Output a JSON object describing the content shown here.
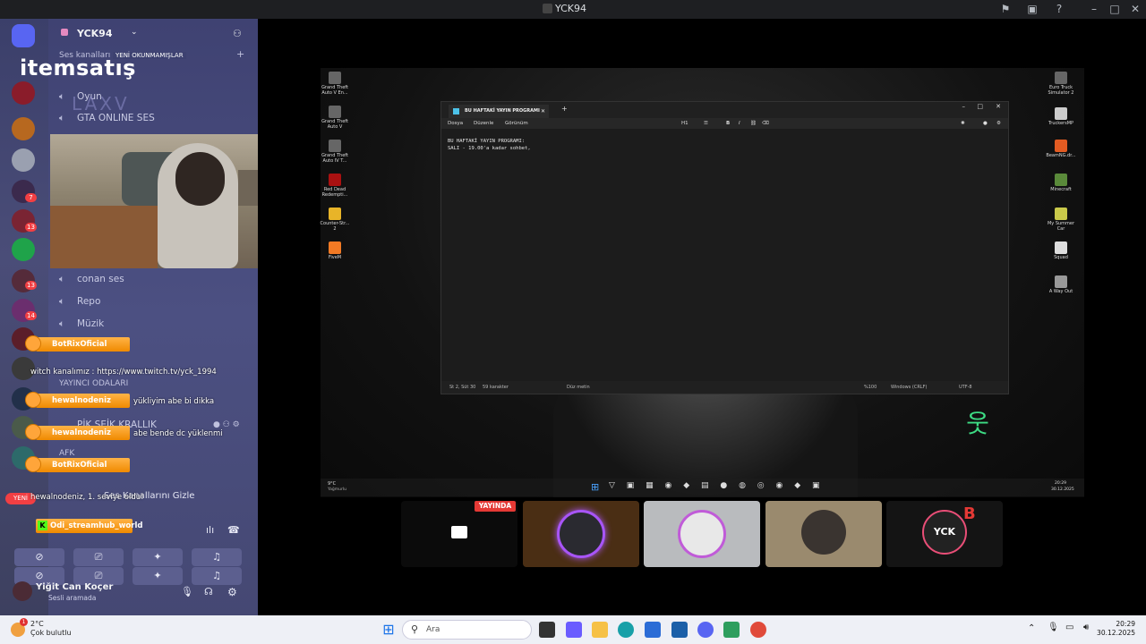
{
  "window": {
    "title": "YCK94"
  },
  "server": {
    "name": "YCK94"
  },
  "watermark": {
    "brand": "itemsatış",
    "sub": "LAXV"
  },
  "channels": {
    "category_voice": "Ses kanalları",
    "unread_label": "YENİ OKUNMAMIŞLAR",
    "items": [
      "Oyun",
      "GTA ONLINE SES",
      "conan ses",
      "Repo",
      "Müzik"
    ],
    "stream_category": "YAYINCI ODALARI",
    "kingdom": "PİK SEİK KRALLIK",
    "afk": "AFK",
    "hide_label": "Ses Kanallarını Gizle",
    "new_label": "YENİ"
  },
  "overlay": {
    "bot1": "BotRixOficial",
    "twitch_line": "witch kanalımız : https://www.twitch.tv/yck_1994",
    "user1": "hewalnodeniz",
    "msg1": "yükliyim abe bi dikka",
    "user2": "hewalnodeniz",
    "msg2": "abe bende dc yüklenmi",
    "bot2": "BotRixOficial",
    "level_line": "hewalnodeniz, 1. seviye oldu!",
    "kick_user": "Odi_streamhub_world"
  },
  "user": {
    "name": "Yiğit Can Koçer",
    "status": "Sesli aramada"
  },
  "notepad": {
    "tab_title": "BU HAFTAKİ YAYIN PROGRAMI",
    "menu": [
      "Dosya",
      "Düzenle",
      "Görünüm"
    ],
    "heading_tool": "H1",
    "lines": [
      "BU HAFTAKİ YAYIN PROGRAMI:",
      "SALI - 19.00'a kadar sohbet,"
    ],
    "status": {
      "pos": "St 2, Süt 30",
      "chars": "59 karakter",
      "mode": "Düz metin",
      "zoom": "%100",
      "eol": "Windows (CRLF)",
      "enc": "UTF-8"
    }
  },
  "desktop_icons_left": [
    "Grand Theft Auto V En...",
    "Grand Theft Auto V",
    "Grand Theft Auto IV T...",
    "Red Dead Redempti...",
    "Counter-Str... 2",
    "FiveM"
  ],
  "desktop_icons_right": [
    "Euro Truck Simulator 2",
    "TruckersMP",
    "BeamNG.dr...",
    "Minecraft",
    "My Summer Car",
    "Squad",
    "A Way Out"
  ],
  "inner_taskbar": {
    "weather": "9°C",
    "weather_sub": "Yağmurlu",
    "time": "20:29",
    "date": "30.12.2025"
  },
  "tiles": {
    "live_badge": "YAYINDA",
    "last_tile_text": "YCK"
  },
  "taskbar": {
    "temp": "2°C",
    "condition": "Çok bulutlu",
    "notif_count": "1",
    "search_placeholder": "Ara",
    "time": "20:29",
    "date": "30.12.2025"
  },
  "colors": {
    "discord_blurple": "#5865f2",
    "overlay_orange": "#f39c1c",
    "live_red": "#e53935"
  }
}
